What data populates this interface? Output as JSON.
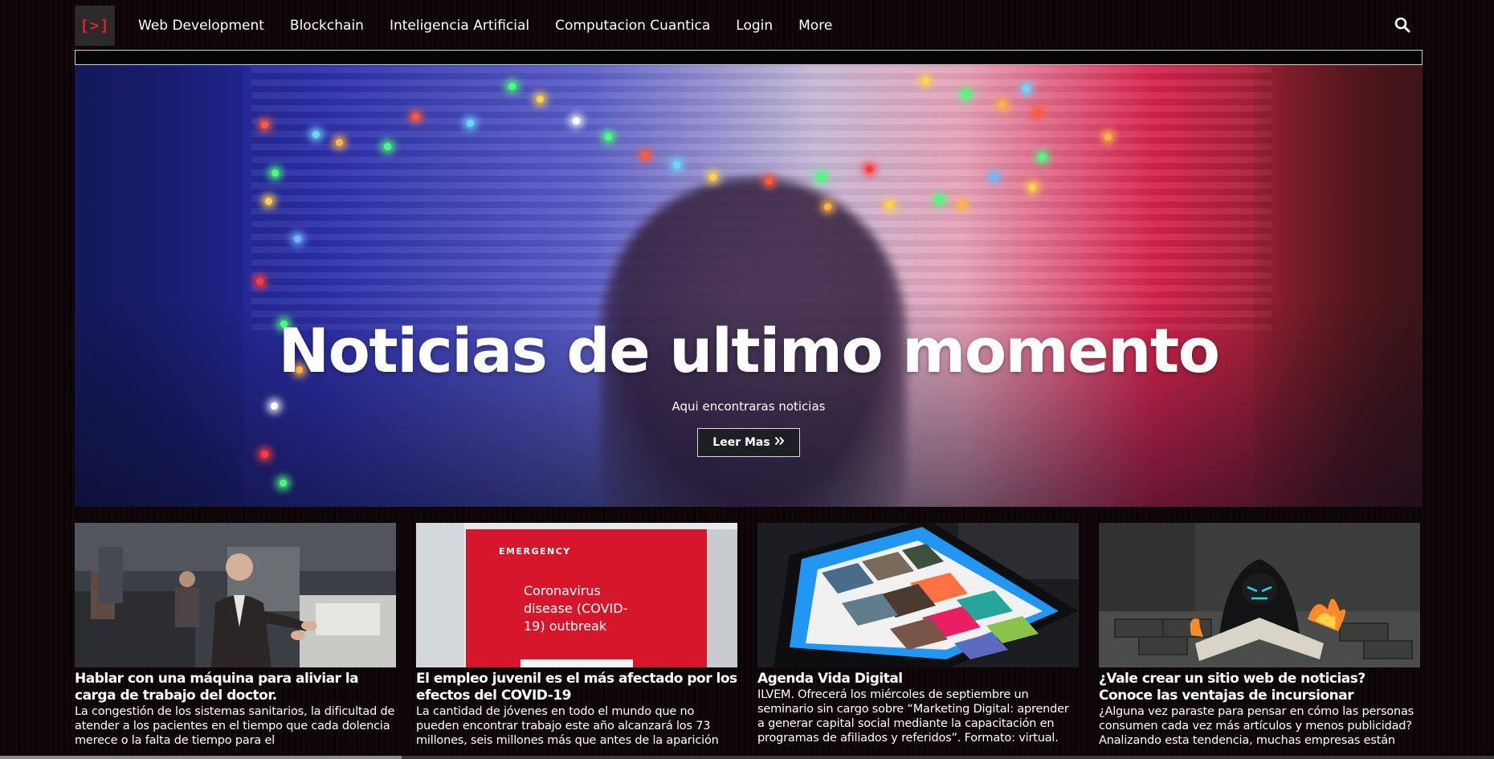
{
  "navbar": {
    "brand": "[>]",
    "links": [
      {
        "label": "Web Development"
      },
      {
        "label": "Blockchain"
      },
      {
        "label": "Inteligencia Artificial"
      },
      {
        "label": "Computacion Cuantica"
      },
      {
        "label": "Login"
      },
      {
        "label": "More"
      }
    ],
    "search_icon": "search-icon"
  },
  "hero": {
    "title": "Noticias de ultimo momento",
    "subtitle": "Aqui encontraras noticias",
    "button_label": "Leer Mas",
    "button_icon": "double-chevron-right-icon"
  },
  "cards": [
    {
      "title": "Hablar con una máquina para aliviar la carga de trabajo del doctor.",
      "text": "La congestión de los sistemas sanitarios, la dificultad de atender a los pacientes en el tiempo que cada dolencia merece o la falta de tiempo para el"
    },
    {
      "title": "El empleo juvenil es el más afectado por los efectos del COVID-19",
      "text": "La cantidad de jóvenes en todo el mundo que no pueden encontrar trabajo este año alcanzará los 73 millones, seis millones más que antes de la aparición"
    },
    {
      "title": "Agenda Vida Digital",
      "text": "ILVEM. Ofrecerá los miércoles de septiembre un seminario sin cargo sobre “Marketing Digital: aprender a generar capital social mediante la capacitación en programas de afiliados y referidos”. Formato: virtual."
    },
    {
      "title": "¿Vale crear un sitio web de noticias? Conoce las ventajas de incursionar",
      "text": "¿Alguna vez paraste para pensar en cómo las personas consumen cada vez más artículos y menos publicidad? Analizando esta tendencia, muchas empresas están"
    }
  ],
  "card_images": {
    "card2_sign_header": "EMERGENCY",
    "card2_sign_text": "Coronavirus disease (COVID-19) outbreak"
  },
  "colors": {
    "brand_accent": "#e0202e",
    "background": "#070305",
    "button_bg": "#1e1f22"
  }
}
